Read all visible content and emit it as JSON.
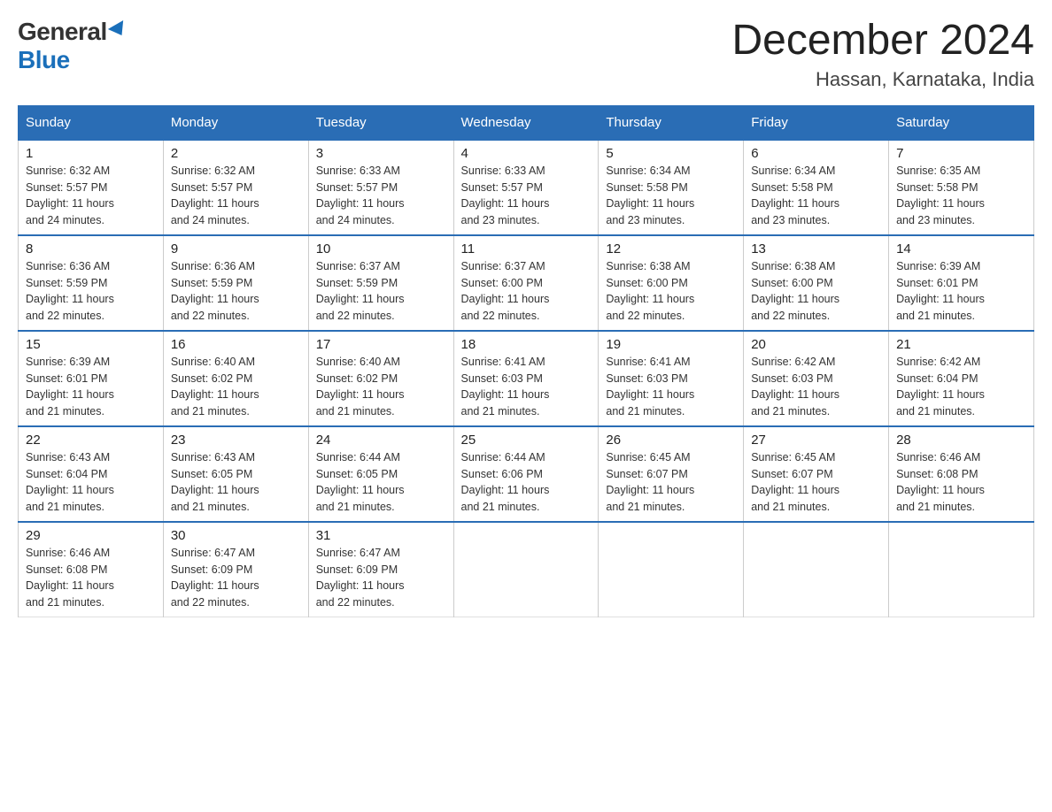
{
  "logo": {
    "general": "General",
    "blue": "Blue"
  },
  "title": {
    "month": "December 2024",
    "location": "Hassan, Karnataka, India"
  },
  "headers": [
    "Sunday",
    "Monday",
    "Tuesday",
    "Wednesday",
    "Thursday",
    "Friday",
    "Saturday"
  ],
  "weeks": [
    [
      {
        "day": "1",
        "sunrise": "6:32 AM",
        "sunset": "5:57 PM",
        "daylight": "11 hours and 24 minutes."
      },
      {
        "day": "2",
        "sunrise": "6:32 AM",
        "sunset": "5:57 PM",
        "daylight": "11 hours and 24 minutes."
      },
      {
        "day": "3",
        "sunrise": "6:33 AM",
        "sunset": "5:57 PM",
        "daylight": "11 hours and 24 minutes."
      },
      {
        "day": "4",
        "sunrise": "6:33 AM",
        "sunset": "5:57 PM",
        "daylight": "11 hours and 23 minutes."
      },
      {
        "day": "5",
        "sunrise": "6:34 AM",
        "sunset": "5:58 PM",
        "daylight": "11 hours and 23 minutes."
      },
      {
        "day": "6",
        "sunrise": "6:34 AM",
        "sunset": "5:58 PM",
        "daylight": "11 hours and 23 minutes."
      },
      {
        "day": "7",
        "sunrise": "6:35 AM",
        "sunset": "5:58 PM",
        "daylight": "11 hours and 23 minutes."
      }
    ],
    [
      {
        "day": "8",
        "sunrise": "6:36 AM",
        "sunset": "5:59 PM",
        "daylight": "11 hours and 22 minutes."
      },
      {
        "day": "9",
        "sunrise": "6:36 AM",
        "sunset": "5:59 PM",
        "daylight": "11 hours and 22 minutes."
      },
      {
        "day": "10",
        "sunrise": "6:37 AM",
        "sunset": "5:59 PM",
        "daylight": "11 hours and 22 minutes."
      },
      {
        "day": "11",
        "sunrise": "6:37 AM",
        "sunset": "6:00 PM",
        "daylight": "11 hours and 22 minutes."
      },
      {
        "day": "12",
        "sunrise": "6:38 AM",
        "sunset": "6:00 PM",
        "daylight": "11 hours and 22 minutes."
      },
      {
        "day": "13",
        "sunrise": "6:38 AM",
        "sunset": "6:00 PM",
        "daylight": "11 hours and 22 minutes."
      },
      {
        "day": "14",
        "sunrise": "6:39 AM",
        "sunset": "6:01 PM",
        "daylight": "11 hours and 21 minutes."
      }
    ],
    [
      {
        "day": "15",
        "sunrise": "6:39 AM",
        "sunset": "6:01 PM",
        "daylight": "11 hours and 21 minutes."
      },
      {
        "day": "16",
        "sunrise": "6:40 AM",
        "sunset": "6:02 PM",
        "daylight": "11 hours and 21 minutes."
      },
      {
        "day": "17",
        "sunrise": "6:40 AM",
        "sunset": "6:02 PM",
        "daylight": "11 hours and 21 minutes."
      },
      {
        "day": "18",
        "sunrise": "6:41 AM",
        "sunset": "6:03 PM",
        "daylight": "11 hours and 21 minutes."
      },
      {
        "day": "19",
        "sunrise": "6:41 AM",
        "sunset": "6:03 PM",
        "daylight": "11 hours and 21 minutes."
      },
      {
        "day": "20",
        "sunrise": "6:42 AM",
        "sunset": "6:03 PM",
        "daylight": "11 hours and 21 minutes."
      },
      {
        "day": "21",
        "sunrise": "6:42 AM",
        "sunset": "6:04 PM",
        "daylight": "11 hours and 21 minutes."
      }
    ],
    [
      {
        "day": "22",
        "sunrise": "6:43 AM",
        "sunset": "6:04 PM",
        "daylight": "11 hours and 21 minutes."
      },
      {
        "day": "23",
        "sunrise": "6:43 AM",
        "sunset": "6:05 PM",
        "daylight": "11 hours and 21 minutes."
      },
      {
        "day": "24",
        "sunrise": "6:44 AM",
        "sunset": "6:05 PM",
        "daylight": "11 hours and 21 minutes."
      },
      {
        "day": "25",
        "sunrise": "6:44 AM",
        "sunset": "6:06 PM",
        "daylight": "11 hours and 21 minutes."
      },
      {
        "day": "26",
        "sunrise": "6:45 AM",
        "sunset": "6:07 PM",
        "daylight": "11 hours and 21 minutes."
      },
      {
        "day": "27",
        "sunrise": "6:45 AM",
        "sunset": "6:07 PM",
        "daylight": "11 hours and 21 minutes."
      },
      {
        "day": "28",
        "sunrise": "6:46 AM",
        "sunset": "6:08 PM",
        "daylight": "11 hours and 21 minutes."
      }
    ],
    [
      {
        "day": "29",
        "sunrise": "6:46 AM",
        "sunset": "6:08 PM",
        "daylight": "11 hours and 21 minutes."
      },
      {
        "day": "30",
        "sunrise": "6:47 AM",
        "sunset": "6:09 PM",
        "daylight": "11 hours and 22 minutes."
      },
      {
        "day": "31",
        "sunrise": "6:47 AM",
        "sunset": "6:09 PM",
        "daylight": "11 hours and 22 minutes."
      },
      null,
      null,
      null,
      null
    ]
  ],
  "labels": {
    "sunrise": "Sunrise:",
    "sunset": "Sunset:",
    "daylight": "Daylight:"
  }
}
